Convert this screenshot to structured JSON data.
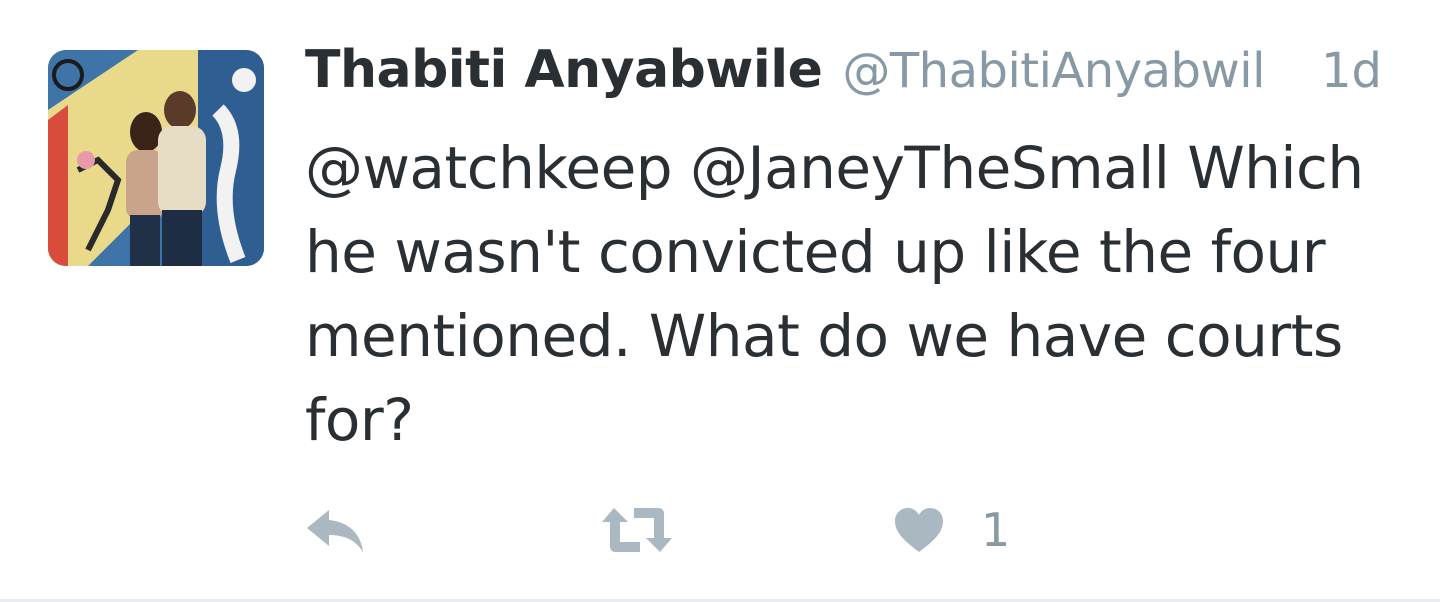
{
  "tweet": {
    "author_name": "Thabiti Anyabwile",
    "author_handle": "@ThabitiAnyabwil",
    "timestamp": "1d",
    "text": "@watchkeep @JaneyTheSmall Which he wasn't convicted up like the four mentioned. What do we have courts for?",
    "like_count": "1"
  },
  "icons": {
    "reply": "reply-icon",
    "retweet": "retweet-icon",
    "like": "heart-icon"
  },
  "colors": {
    "name": "#292f33",
    "meta": "#8899a6",
    "action_icon": "#aab8c2",
    "divider": "#e6ecf0"
  }
}
